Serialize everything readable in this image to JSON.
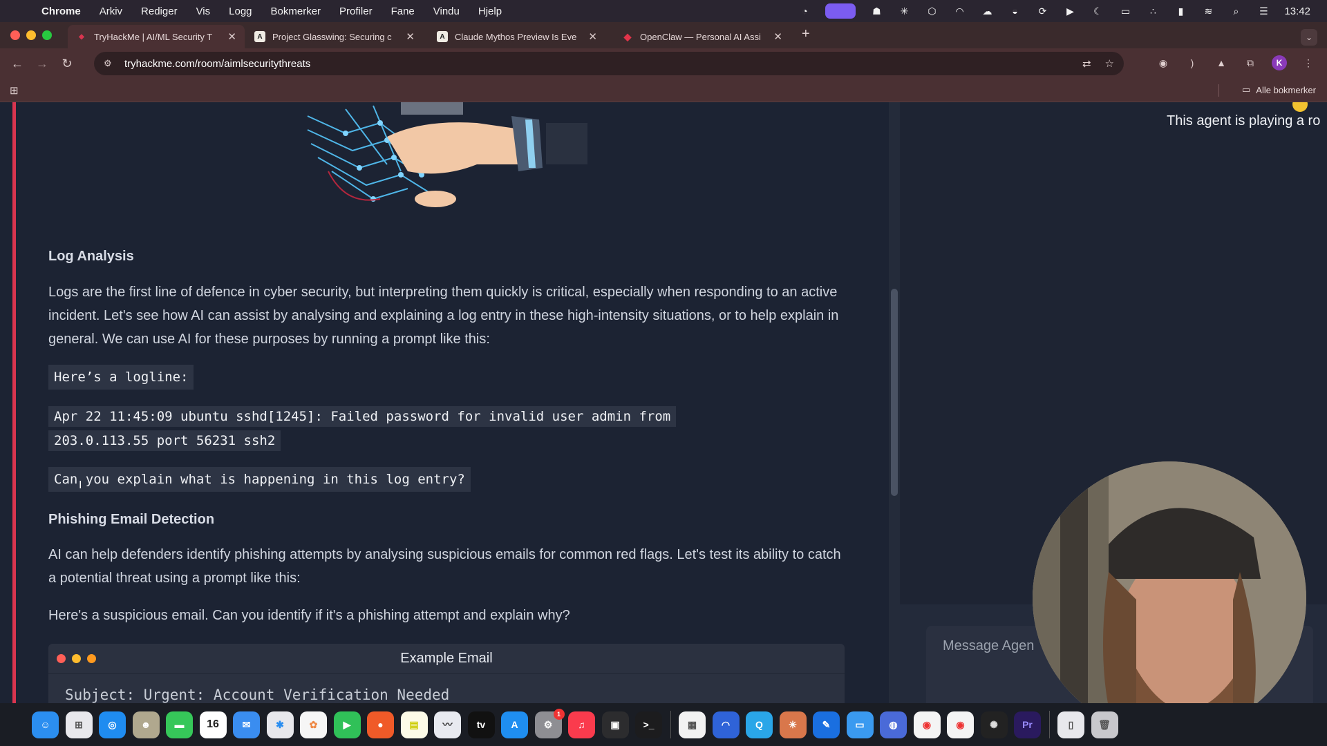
{
  "menubar": {
    "app_name": "Chrome",
    "menus": [
      "Arkiv",
      "Rediger",
      "Vis",
      "Logg",
      "Bokmerker",
      "Profiler",
      "Fane",
      "Vindu",
      "Hjelp"
    ],
    "clock": "13:42"
  },
  "tabs": [
    {
      "title": "TryHackMe | AI/ML Security T",
      "favicon": "tryhackme-icon",
      "active": true
    },
    {
      "title": "Project Glasswing: Securing c",
      "favicon": "anthropic-icon",
      "active": false
    },
    {
      "title": "Claude Mythos Preview Is Eve",
      "favicon": "anthropic-icon",
      "active": false
    },
    {
      "title": "OpenClaw — Personal AI Assi",
      "favicon": "openclaw-icon",
      "active": false
    }
  ],
  "toolbar": {
    "url": "tryhackme.com/room/aimlsecuritythreats",
    "avatar_letter": "K"
  },
  "bookmarks": {
    "all_bookmarks_label": "Alle bokmerker"
  },
  "article": {
    "log_heading": "Log Analysis",
    "log_paragraph": "Logs are the first line of defence in cyber security, but interpreting them quickly is critical, especially when responding to an active incident. Let's see how AI can assist by analysing and explaining a log entry in these high-intensity situations, or to help explain in general. We can use AI for these purposes by running a prompt like this:",
    "code_logline_label": "Here’s a logline:",
    "code_logline_1": "Apr 22 11:45:09 ubuntu sshd[1245]: Failed password for invalid user admin from",
    "code_logline_2": "203.0.113.55 port 56231 ssh2",
    "code_question": "Can you explain what is happening in this log entry?",
    "phishing_heading": "Phishing Email Detection",
    "phishing_paragraph": "AI can help defenders identify phishing attempts by analysing suspicious emails for common red flags. Let's test its ability to catch a potential threat using a prompt like this:",
    "phishing_prompt": "Here's a suspicious email. Can you identify if it's a phishing attempt and explain why?",
    "email_title": "Example Email",
    "email_subject": "Subject: Urgent: Account Verification Needed"
  },
  "agent_panel": {
    "text": "This agent is playing a ro",
    "message_placeholder": "Message Agen"
  },
  "dock": {
    "calendar_day": "16",
    "badge_count": "1"
  },
  "colors": {
    "accent_red": "#d9354f",
    "tab_bar": "#3a2a2c",
    "toolbar": "#4a3033",
    "page_bg": "#1c2333"
  }
}
